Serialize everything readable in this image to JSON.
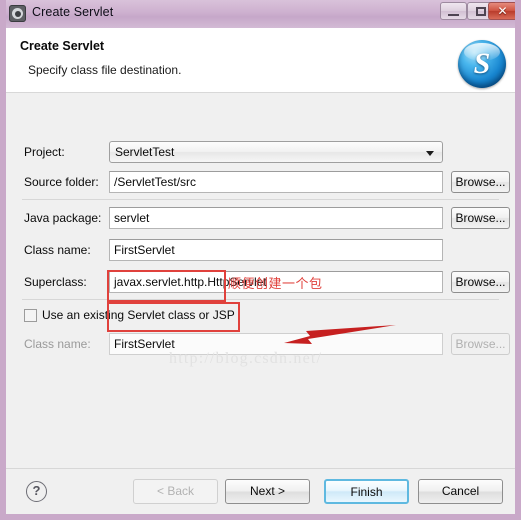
{
  "window": {
    "title": "Create Servlet",
    "icon": "gear-icon",
    "controls": {
      "minimize": "–",
      "maximize": "□",
      "close": "✕"
    }
  },
  "header": {
    "title": "Create Servlet",
    "description": "Specify class file destination.",
    "logo_letter": "S"
  },
  "form": {
    "project": {
      "label": "Project:",
      "value": "ServletTest"
    },
    "source_folder": {
      "label": "Source folder:",
      "value": "/ServletTest/src",
      "browse_label": "Browse..."
    },
    "java_package": {
      "label": "Java package:",
      "value": "servlet",
      "browse_label": "Browse..."
    },
    "class_name": {
      "label": "Class name:",
      "value": "FirstServlet"
    },
    "superclass": {
      "label": "Superclass:",
      "value": "javax.servlet.http.HttpServlet",
      "browse_label": "Browse..."
    },
    "use_existing": {
      "label": "Use an existing Servlet class or JSP",
      "checked": false
    },
    "existing_class_name": {
      "label": "Class name:",
      "value": "FirstServlet",
      "browse_label": "Browse...",
      "disabled": true
    }
  },
  "annotations": {
    "note_text": "顺便创建一个包",
    "note_color": "#e0413c",
    "arrow_color": "#c62020",
    "watermark": "http://blog.csdn.net/"
  },
  "footer": {
    "help_label": "?",
    "back_label": "< Back",
    "next_label": "Next >",
    "finish_label": "Finish",
    "cancel_label": "Cancel"
  }
}
